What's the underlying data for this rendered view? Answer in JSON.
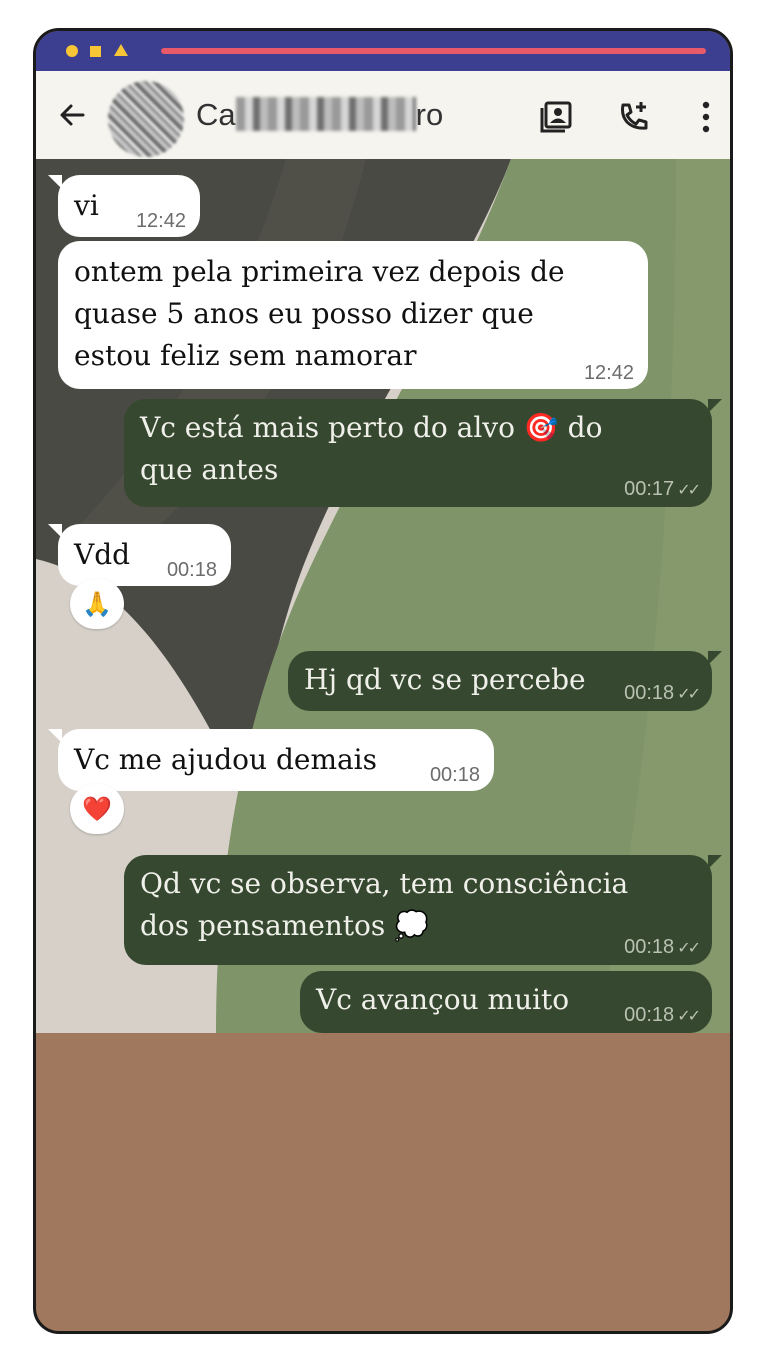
{
  "header": {
    "contact_name_prefix": "Ca",
    "contact_name_suffix": "ro",
    "back_icon": "arrow-left-icon",
    "contact_card_icon": "contact-card-icon",
    "call_icon": "phone-add-icon",
    "menu_icon": "more-vertical-icon"
  },
  "colors": {
    "status_bar": "#3c3f8f",
    "status_accent": "#f6c637",
    "status_line": "#e8596a",
    "header_bg": "#f5f4ef",
    "incoming_bubble": "#ffffff",
    "outgoing_bubble": "#36482f",
    "below_chat": "#a0785e"
  },
  "messages": [
    {
      "direction": "in",
      "text": "vi",
      "time": "12:42"
    },
    {
      "direction": "in",
      "lines": [
        "ontem pela primeira vez depois de",
        "quase 5 anos eu posso dizer que",
        "estou feliz sem namorar"
      ],
      "time": "12:42"
    },
    {
      "direction": "out",
      "line1": "Vc está mais perto do alvo",
      "emoji": "🎯",
      "line1b": "do",
      "line2": "que antes",
      "time": "00:17",
      "ticks": "✓✓"
    },
    {
      "direction": "in",
      "text": "Vdd",
      "time": "00:18",
      "reaction": "🙏"
    },
    {
      "direction": "out",
      "text": "Hj qd vc se percebe",
      "time": "00:18",
      "ticks": "✓✓"
    },
    {
      "direction": "in",
      "text": "Vc me ajudou demais",
      "time": "00:18",
      "reaction": "❤️"
    },
    {
      "direction": "out",
      "line1": "Qd vc se observa, tem consciência",
      "line2": "dos pensamentos",
      "emoji": "💭",
      "time": "00:18",
      "ticks": "✓✓"
    },
    {
      "direction": "out",
      "text": "Vc avançou muito",
      "time": "00:18",
      "ticks": "✓✓"
    }
  ]
}
